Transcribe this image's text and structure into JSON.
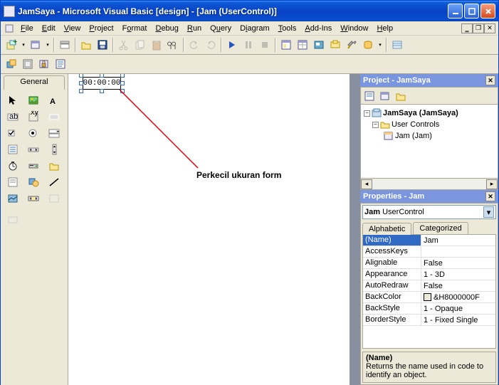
{
  "titlebar": {
    "text": "JamSaya - Microsoft Visual Basic [design] - [Jam (UserControl)]"
  },
  "menu": {
    "items": [
      {
        "label": "File",
        "u": "F"
      },
      {
        "label": "Edit",
        "u": "E"
      },
      {
        "label": "View",
        "u": "V"
      },
      {
        "label": "Project",
        "u": "P"
      },
      {
        "label": "Format",
        "u": "o",
        "full": "Format"
      },
      {
        "label": "Debug",
        "u": "D"
      },
      {
        "label": "Run",
        "u": "R"
      },
      {
        "label": "Query",
        "u": "u",
        "full": "Query"
      },
      {
        "label": "Diagram",
        "u": "i",
        "full": "Diagram"
      },
      {
        "label": "Tools",
        "u": "T"
      },
      {
        "label": "Add-Ins",
        "u": "A"
      },
      {
        "label": "Window",
        "u": "W"
      },
      {
        "label": "Help",
        "u": "H"
      }
    ]
  },
  "toolbox": {
    "tab": "General"
  },
  "design": {
    "control_text": "00:00:00"
  },
  "annotation": {
    "text": "Perkecil ukuran form"
  },
  "project_panel": {
    "title": "Project - JamSaya",
    "root": "JamSaya (JamSaya)",
    "folder": "User Controls",
    "item": "Jam (Jam)"
  },
  "properties_panel": {
    "title": "Properties - Jam",
    "object_name": "Jam",
    "object_type": "UserControl",
    "tabs": {
      "alpha": "Alphabetic",
      "cat": "Categorized"
    },
    "rows": [
      {
        "name": "(Name)",
        "value": "Jam",
        "selected": true
      },
      {
        "name": "AccessKeys",
        "value": ""
      },
      {
        "name": "Alignable",
        "value": "False"
      },
      {
        "name": "Appearance",
        "value": "1 - 3D"
      },
      {
        "name": "AutoRedraw",
        "value": "False"
      },
      {
        "name": "BackColor",
        "value": "&H8000000F",
        "swatch": true
      },
      {
        "name": "BackStyle",
        "value": "1 - Opaque"
      },
      {
        "name": "BorderStyle",
        "value": "1 - Fixed Single"
      }
    ],
    "desc_name": "(Name)",
    "desc_text": "Returns the name used in code to identify an object."
  }
}
